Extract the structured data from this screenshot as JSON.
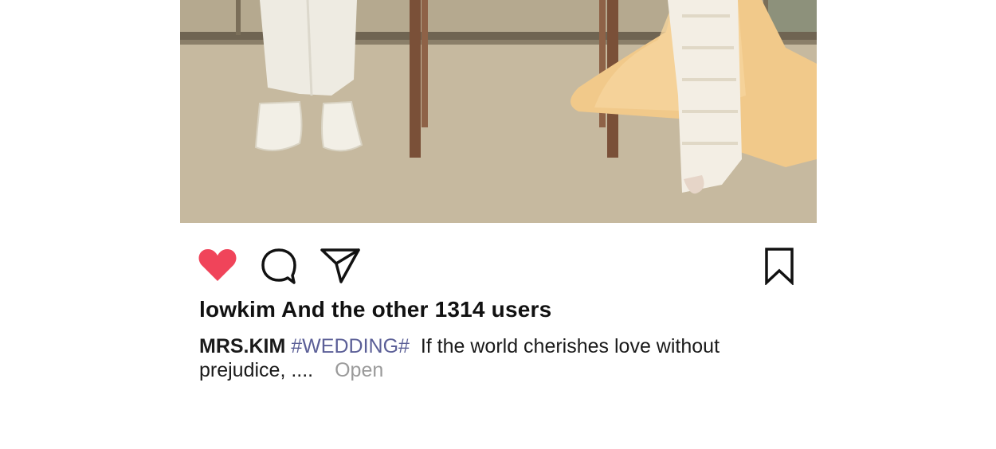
{
  "post": {
    "image_alt": "wedding photo: couple's feet in white shoes and gold gown beside wooden chair legs",
    "actions": {
      "like_icon": "heart-filled-icon",
      "comment_icon": "speech-bubble-icon",
      "share_icon": "paper-plane-icon",
      "save_icon": "bookmark-icon"
    },
    "likes_text": "lowkim And the other 1314 users",
    "caption": {
      "username": "MRS.KIM",
      "hashtag": "#WEDDING#",
      "text": "If the world cherishes love without prejudice, ....",
      "open_label": "Open"
    }
  },
  "colors": {
    "heart": "#f0445a",
    "hashtag": "#5b5f97",
    "open_link": "#9a9a9a"
  }
}
